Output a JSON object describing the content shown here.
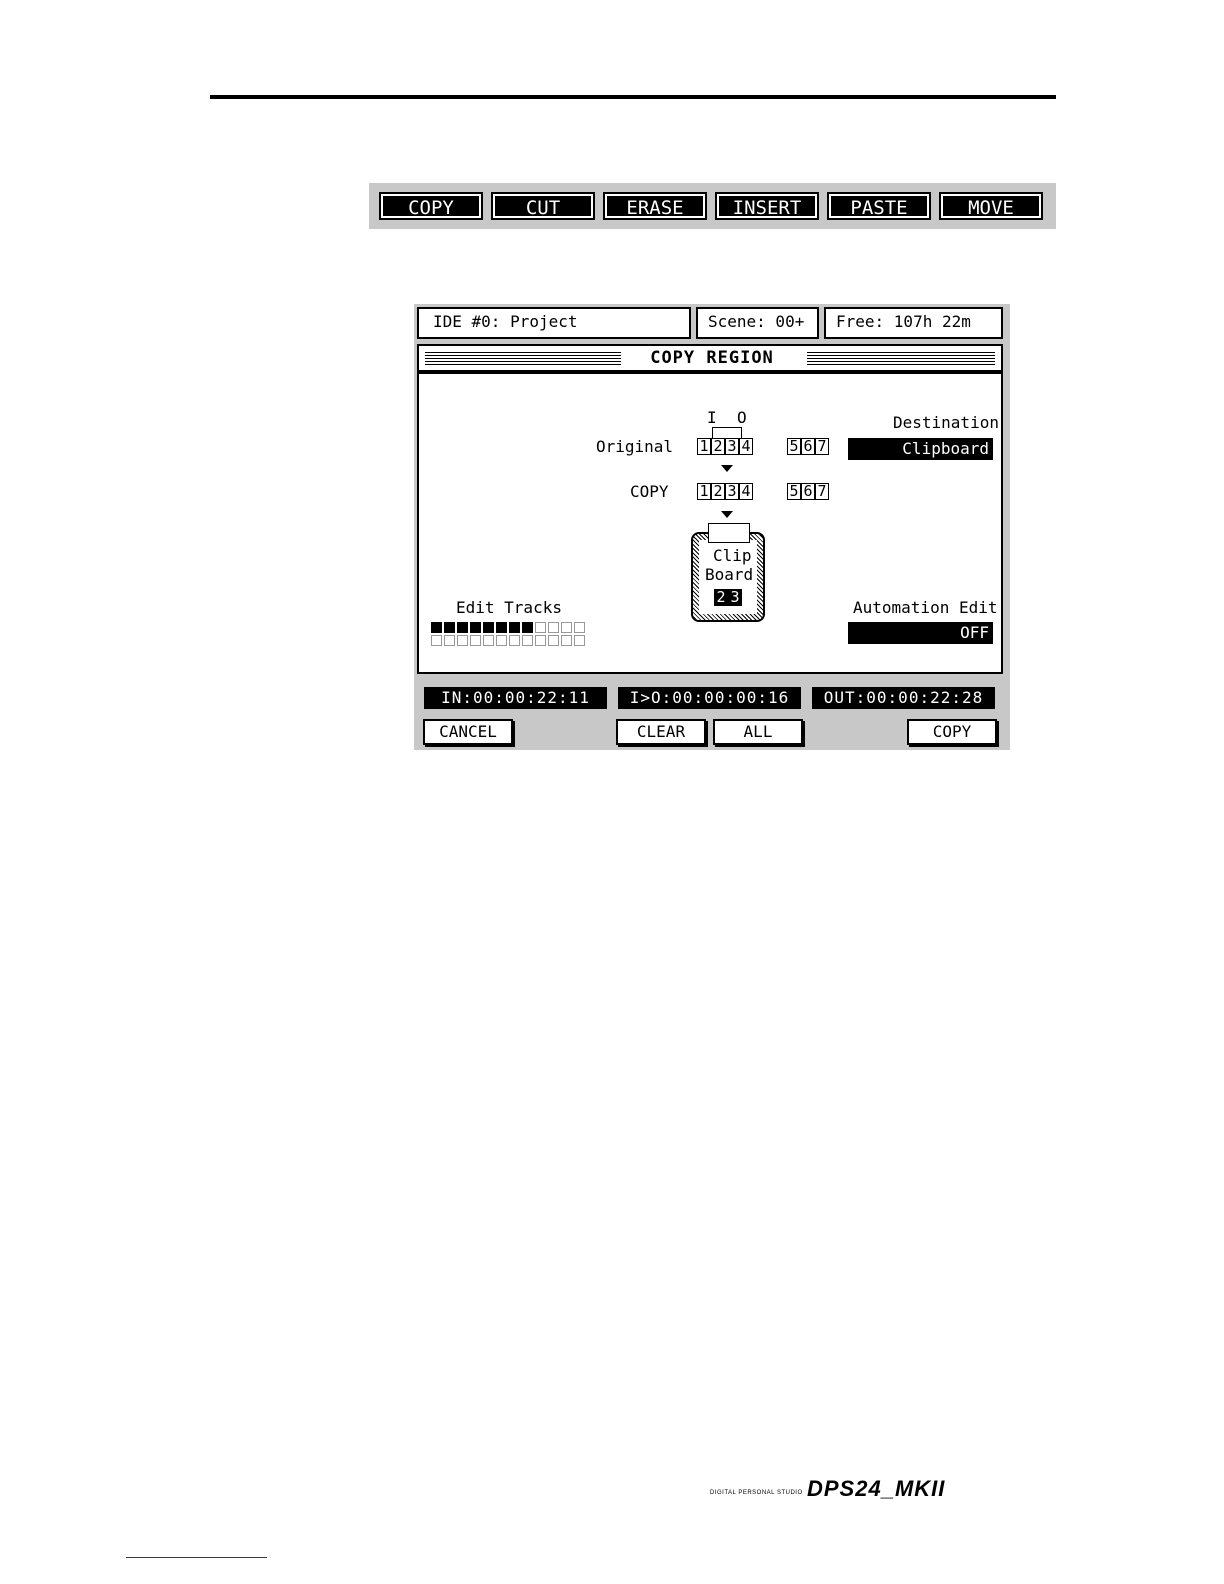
{
  "softkeys": [
    "COPY",
    "CUT",
    "ERASE",
    "INSERT",
    "PASTE",
    "MOVE"
  ],
  "header": {
    "project": "IDE #0: Project",
    "scene": "Scene: 00+",
    "free": "Free: 107h 22m"
  },
  "title": "COPY REGION",
  "diagram": {
    "in_marker": "I",
    "out_marker": "O",
    "original_label": "Original",
    "copy_label": "COPY",
    "tracks_a": [
      "1",
      "2",
      "3",
      "4"
    ],
    "tracks_b": [
      "5",
      "6",
      "7"
    ],
    "clipboard_line1": "Clip",
    "clipboard_line2": "Board",
    "clipboard_digits": [
      "2",
      "3"
    ]
  },
  "destination": {
    "label": "Destination",
    "value": "Clipboard"
  },
  "automation": {
    "label": "Automation Edit",
    "value": "OFF"
  },
  "edit_tracks": {
    "label": "Edit Tracks",
    "total": 24,
    "selected": 8
  },
  "timecodes": {
    "in": "IN:00:00:22:11",
    "length": "I>O:00:00:00:16",
    "out": "OUT:00:00:22:28"
  },
  "buttons": {
    "cancel": "CANCEL",
    "clear": "CLEAR",
    "all": "ALL",
    "copy": "COPY"
  },
  "brand": {
    "small": "DIGITAL PERSONAL STUDIO",
    "model": "DPS24_MKII"
  }
}
